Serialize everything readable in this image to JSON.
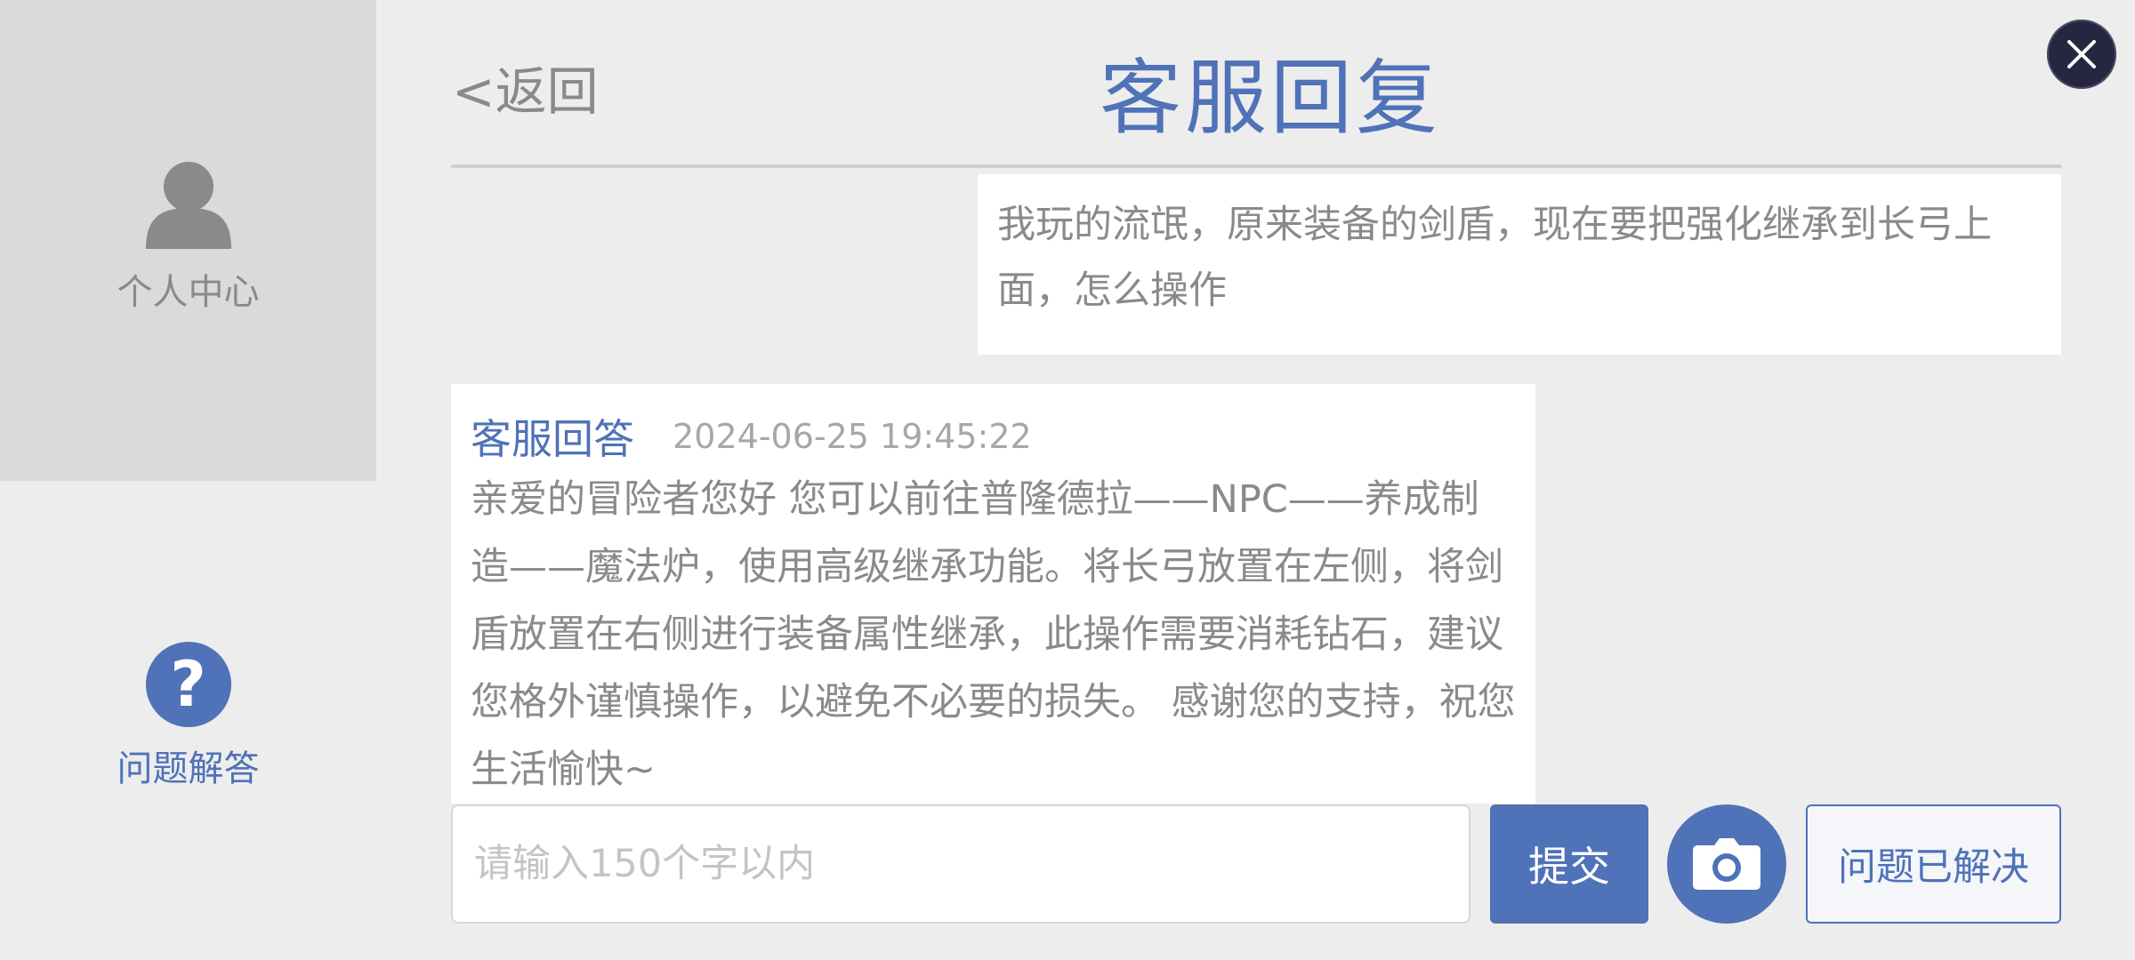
{
  "sidebar": {
    "items": [
      {
        "label": "个人中心",
        "icon": "user-icon"
      },
      {
        "label": "问题解答",
        "icon": "question-icon"
      }
    ]
  },
  "header": {
    "back_label": "<返回",
    "title": "客服回复",
    "close_icon": "close-icon"
  },
  "messages": {
    "user": {
      "text": "我玩的流氓，原来装备的剑盾，现在要把强化继承到长弓上面，怎么操作"
    },
    "reply": {
      "author": "客服回答",
      "timestamp": "2024-06-25 19:45:22",
      "text": "亲爱的冒险者您好 您可以前往普隆德拉——NPC——养成制造——魔法炉，使用高级继承功能。将长弓放置在左侧，将剑盾放置在右侧进行装备属性继承，此操作需要消耗钻石，建议您格外谨慎操作，以避免不必要的损失。 感谢您的支持，祝您生活愉快~"
    }
  },
  "footer": {
    "input_value": "",
    "input_placeholder": "请输入150个字以内",
    "submit_label": "提交",
    "camera_icon": "camera-icon",
    "resolved_label": "问题已解决"
  },
  "colors": {
    "accent": "#4f72b8",
    "muted_text": "#8a8a8a",
    "background": "#ededed",
    "sidebar_active": "#dadada"
  }
}
